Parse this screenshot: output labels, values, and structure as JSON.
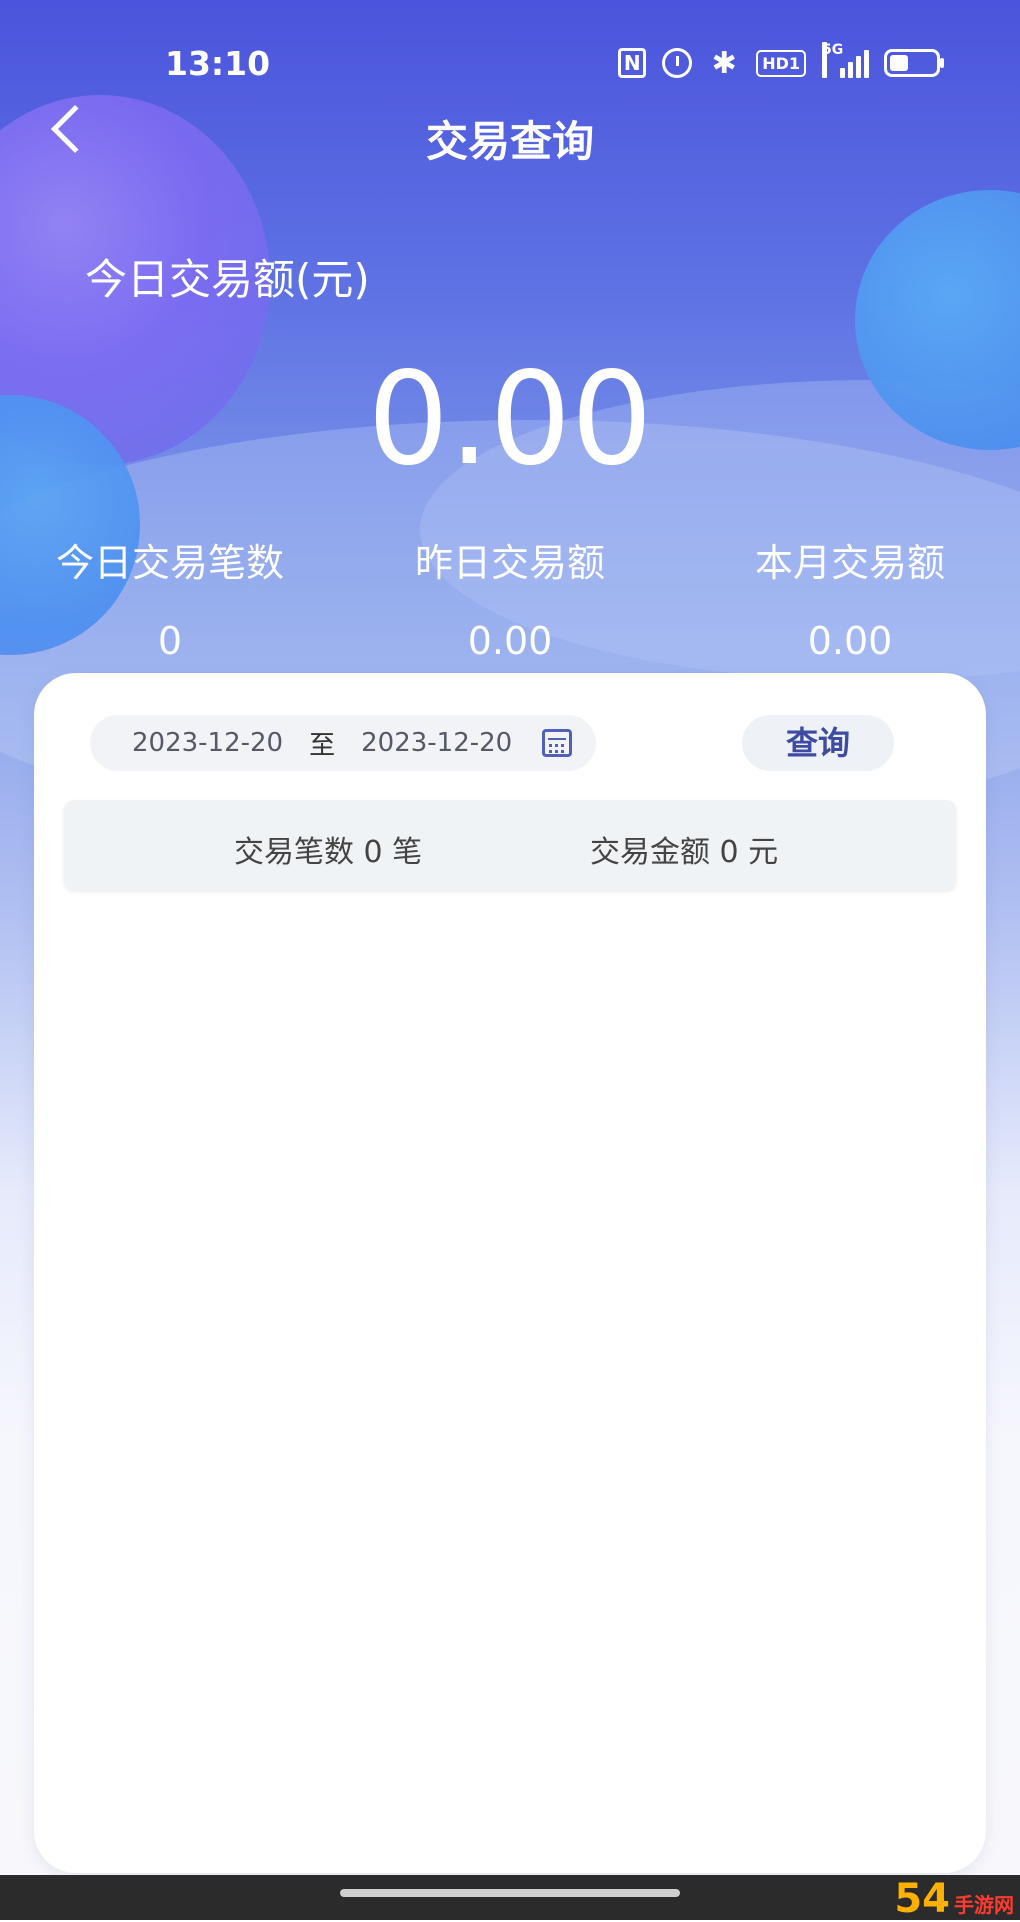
{
  "status_bar": {
    "time": "13:10",
    "nfc": "N",
    "hd": "HD1",
    "network": "5G"
  },
  "header": {
    "title": "交易查询"
  },
  "summary_top": {
    "today_amount_label": "今日交易额(元)",
    "today_amount_value": "0.00",
    "stats": [
      {
        "label": "今日交易笔数",
        "value": "0"
      },
      {
        "label": "昨日交易额",
        "value": "0.00"
      },
      {
        "label": "本月交易额",
        "value": "0.00"
      }
    ]
  },
  "query": {
    "start_date": "2023-12-20",
    "separator": "至",
    "end_date": "2023-12-20",
    "button_label": "查询"
  },
  "result": {
    "count_text": "交易笔数  0 笔",
    "amount_text": "交易金额  0 元"
  },
  "watermark": {
    "brand": "54",
    "suffix": "手游网"
  },
  "colors": {
    "accent": "#3d4ba3",
    "header_bg": "#4b54dc"
  }
}
